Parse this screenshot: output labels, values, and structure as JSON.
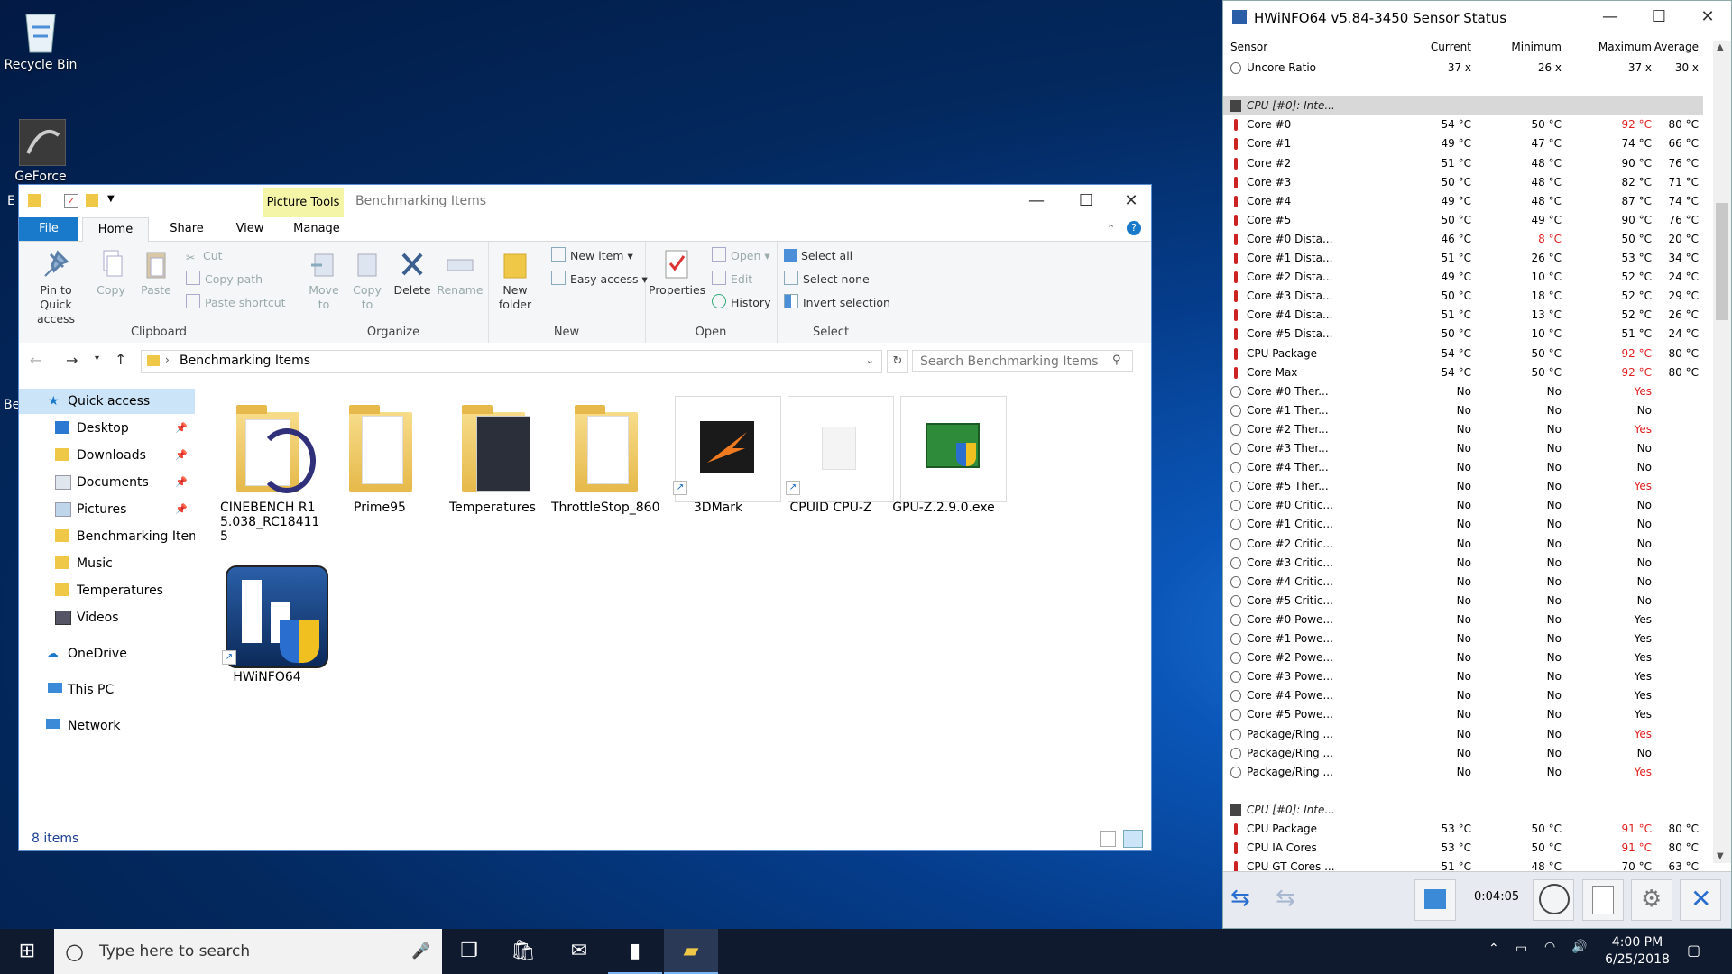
{
  "desktop": {
    "icons": [
      {
        "label": "Recycle Bin"
      },
      {
        "label": "GeForce"
      }
    ],
    "edge_labels": [
      "E",
      "Be"
    ]
  },
  "explorer": {
    "picture_tools": "Picture Tools",
    "title": "Benchmarking Items",
    "tabs": {
      "file": "File",
      "home": "Home",
      "share": "Share",
      "view": "View",
      "manage": "Manage"
    },
    "clipboard": {
      "pin": "Pin to Quick access",
      "copy": "Copy",
      "paste": "Paste",
      "cut": "Cut",
      "copy_path": "Copy path",
      "paste_shortcut": "Paste shortcut",
      "label": "Clipboard"
    },
    "organize": {
      "move_to": "Move to",
      "copy_to": "Copy to",
      "delete": "Delete",
      "rename": "Rename",
      "label": "Organize"
    },
    "new": {
      "new_folder": "New folder",
      "new_item": "New item",
      "easy_access": "Easy access",
      "label": "New"
    },
    "open": {
      "properties": "Properties",
      "open": "Open",
      "edit": "Edit",
      "history": "History",
      "label": "Open"
    },
    "select": {
      "select_all": "Select all",
      "select_none": "Select none",
      "invert": "Invert selection",
      "label": "Select"
    },
    "address": "Benchmarking Items",
    "search_placeholder": "Search Benchmarking Items",
    "nav": [
      {
        "label": "Quick access"
      },
      {
        "label": "Desktop"
      },
      {
        "label": "Downloads"
      },
      {
        "label": "Documents"
      },
      {
        "label": "Pictures"
      },
      {
        "label": "Benchmarking Items"
      },
      {
        "label": "Music"
      },
      {
        "label": "Temperatures"
      },
      {
        "label": "Videos"
      },
      {
        "label": "OneDrive"
      },
      {
        "label": "This PC"
      },
      {
        "label": "Network"
      }
    ],
    "files": [
      {
        "label": "CINEBENCH R15.038_RC184115"
      },
      {
        "label": "Prime95"
      },
      {
        "label": "Temperatures"
      },
      {
        "label": "ThrottleStop_860"
      },
      {
        "label": "3DMark"
      },
      {
        "label": "CPUID CPU-Z"
      },
      {
        "label": "GPU-Z.2.9.0.exe"
      },
      {
        "label": "HWiNFO64"
      }
    ],
    "status": "8 items"
  },
  "hwinfo": {
    "title": "HWiNFO64 v5.84-3450 Sensor Status",
    "headers": {
      "sensor": "Sensor",
      "current": "Current",
      "minimum": "Minimum",
      "maximum": "Maximum",
      "average": "Average"
    },
    "rows": [
      {
        "name": "Uncore Ratio",
        "cur": "37 x",
        "min": "26 x",
        "max": "37 x",
        "avg": "30 x"
      },
      {
        "name": "",
        "cur": "",
        "min": "",
        "max": "",
        "avg": ""
      },
      {
        "name": "CPU [#0]: Inte...",
        "cur": "",
        "min": "",
        "max": "",
        "avg": ""
      },
      {
        "name": "Core #0",
        "cur": "54 °C",
        "min": "50 °C",
        "max": "92 °C",
        "avg": "80 °C"
      },
      {
        "name": "Core #1",
        "cur": "49 °C",
        "min": "47 °C",
        "max": "74 °C",
        "avg": "66 °C"
      },
      {
        "name": "Core #2",
        "cur": "51 °C",
        "min": "48 °C",
        "max": "90 °C",
        "avg": "76 °C"
      },
      {
        "name": "Core #3",
        "cur": "50 °C",
        "min": "48 °C",
        "max": "82 °C",
        "avg": "71 °C"
      },
      {
        "name": "Core #4",
        "cur": "49 °C",
        "min": "48 °C",
        "max": "87 °C",
        "avg": "74 °C"
      },
      {
        "name": "Core #5",
        "cur": "50 °C",
        "min": "49 °C",
        "max": "90 °C",
        "avg": "76 °C"
      },
      {
        "name": "Core #0 Dista...",
        "cur": "46 °C",
        "min": "8 °C",
        "max": "50 °C",
        "avg": "20 °C"
      },
      {
        "name": "Core #1 Dista...",
        "cur": "51 °C",
        "min": "26 °C",
        "max": "53 °C",
        "avg": "34 °C"
      },
      {
        "name": "Core #2 Dista...",
        "cur": "49 °C",
        "min": "10 °C",
        "max": "52 °C",
        "avg": "24 °C"
      },
      {
        "name": "Core #3 Dista...",
        "cur": "50 °C",
        "min": "18 °C",
        "max": "52 °C",
        "avg": "29 °C"
      },
      {
        "name": "Core #4 Dista...",
        "cur": "51 °C",
        "min": "13 °C",
        "max": "52 °C",
        "avg": "26 °C"
      },
      {
        "name": "Core #5 Dista...",
        "cur": "50 °C",
        "min": "10 °C",
        "max": "51 °C",
        "avg": "24 °C"
      },
      {
        "name": "CPU Package",
        "cur": "54 °C",
        "min": "50 °C",
        "max": "92 °C",
        "avg": "80 °C"
      },
      {
        "name": "Core Max",
        "cur": "54 °C",
        "min": "50 °C",
        "max": "92 °C",
        "avg": "80 °C"
      },
      {
        "name": "Core #0 Ther...",
        "cur": "No",
        "min": "No",
        "max": "Yes",
        "avg": ""
      },
      {
        "name": "Core #1 Ther...",
        "cur": "No",
        "min": "No",
        "max": "No",
        "avg": ""
      },
      {
        "name": "Core #2 Ther...",
        "cur": "No",
        "min": "No",
        "max": "Yes",
        "avg": ""
      },
      {
        "name": "Core #3 Ther...",
        "cur": "No",
        "min": "No",
        "max": "No",
        "avg": ""
      },
      {
        "name": "Core #4 Ther...",
        "cur": "No",
        "min": "No",
        "max": "No",
        "avg": ""
      },
      {
        "name": "Core #5 Ther...",
        "cur": "No",
        "min": "No",
        "max": "Yes",
        "avg": ""
      },
      {
        "name": "Core #0 Critic...",
        "cur": "No",
        "min": "No",
        "max": "No",
        "avg": ""
      },
      {
        "name": "Core #1 Critic...",
        "cur": "No",
        "min": "No",
        "max": "No",
        "avg": ""
      },
      {
        "name": "Core #2 Critic...",
        "cur": "No",
        "min": "No",
        "max": "No",
        "avg": ""
      },
      {
        "name": "Core #3 Critic...",
        "cur": "No",
        "min": "No",
        "max": "No",
        "avg": ""
      },
      {
        "name": "Core #4 Critic...",
        "cur": "No",
        "min": "No",
        "max": "No",
        "avg": ""
      },
      {
        "name": "Core #5 Critic...",
        "cur": "No",
        "min": "No",
        "max": "No",
        "avg": ""
      },
      {
        "name": "Core #0 Powe...",
        "cur": "No",
        "min": "No",
        "max": "Yes",
        "avg": ""
      },
      {
        "name": "Core #1 Powe...",
        "cur": "No",
        "min": "No",
        "max": "Yes",
        "avg": ""
      },
      {
        "name": "Core #2 Powe...",
        "cur": "No",
        "min": "No",
        "max": "Yes",
        "avg": ""
      },
      {
        "name": "Core #3 Powe...",
        "cur": "No",
        "min": "No",
        "max": "Yes",
        "avg": ""
      },
      {
        "name": "Core #4 Powe...",
        "cur": "No",
        "min": "No",
        "max": "Yes",
        "avg": ""
      },
      {
        "name": "Core #5 Powe...",
        "cur": "No",
        "min": "No",
        "max": "Yes",
        "avg": ""
      },
      {
        "name": "Package/Ring ...",
        "cur": "No",
        "min": "No",
        "max": "Yes",
        "avg": ""
      },
      {
        "name": "Package/Ring ...",
        "cur": "No",
        "min": "No",
        "max": "No",
        "avg": ""
      },
      {
        "name": "Package/Ring ...",
        "cur": "No",
        "min": "No",
        "max": "Yes",
        "avg": ""
      },
      {
        "name": "",
        "cur": "",
        "min": "",
        "max": "",
        "avg": ""
      },
      {
        "name": "CPU [#0]: Inte...",
        "cur": "",
        "min": "",
        "max": "",
        "avg": ""
      },
      {
        "name": "CPU Package",
        "cur": "53 °C",
        "min": "50 °C",
        "max": "91 °C",
        "avg": "80 °C"
      },
      {
        "name": "CPU IA Cores",
        "cur": "53 °C",
        "min": "50 °C",
        "max": "91 °C",
        "avg": "80 °C"
      },
      {
        "name": "CPU GT Cores ...",
        "cur": "51 °C",
        "min": "48 °C",
        "max": "70 °C",
        "avg": "63 °C"
      }
    ],
    "timer": "0:04:05"
  },
  "taskbar": {
    "search_placeholder": "Type here to search",
    "time": "4:00 PM",
    "date": "6/25/2018"
  },
  "colors": {
    "accent": "#1979ca",
    "alert_red": "#e02020",
    "picture_tools_bg": "#f5f5a8"
  }
}
